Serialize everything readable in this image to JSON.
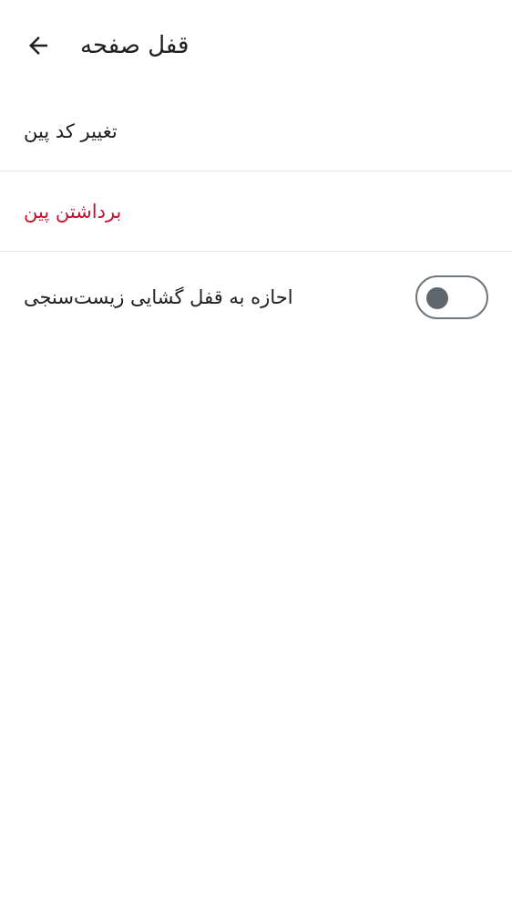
{
  "header": {
    "title": "قفل صفحه",
    "back_icon": "arrow-left-icon"
  },
  "items": [
    {
      "label": "تغییر کد پین",
      "color": "#1f1f1f"
    },
    {
      "label": "برداشتن پین",
      "color": "#c4122f"
    },
    {
      "label": "احازه به قفل گشایی زیست‌سنجی",
      "toggle": {
        "checked": false
      }
    }
  ]
}
